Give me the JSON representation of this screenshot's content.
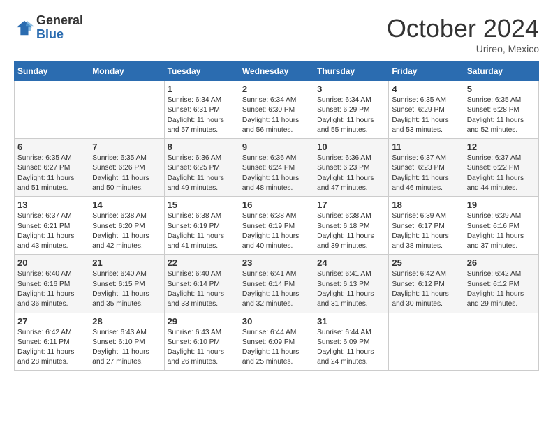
{
  "header": {
    "logo_line1": "General",
    "logo_line2": "Blue",
    "month": "October 2024",
    "location": "Urireo, Mexico"
  },
  "weekdays": [
    "Sunday",
    "Monday",
    "Tuesday",
    "Wednesday",
    "Thursday",
    "Friday",
    "Saturday"
  ],
  "weeks": [
    [
      {
        "day": "",
        "info": ""
      },
      {
        "day": "",
        "info": ""
      },
      {
        "day": "1",
        "info": "Sunrise: 6:34 AM\nSunset: 6:31 PM\nDaylight: 11 hours and 57 minutes."
      },
      {
        "day": "2",
        "info": "Sunrise: 6:34 AM\nSunset: 6:30 PM\nDaylight: 11 hours and 56 minutes."
      },
      {
        "day": "3",
        "info": "Sunrise: 6:34 AM\nSunset: 6:29 PM\nDaylight: 11 hours and 55 minutes."
      },
      {
        "day": "4",
        "info": "Sunrise: 6:35 AM\nSunset: 6:29 PM\nDaylight: 11 hours and 53 minutes."
      },
      {
        "day": "5",
        "info": "Sunrise: 6:35 AM\nSunset: 6:28 PM\nDaylight: 11 hours and 52 minutes."
      }
    ],
    [
      {
        "day": "6",
        "info": "Sunrise: 6:35 AM\nSunset: 6:27 PM\nDaylight: 11 hours and 51 minutes."
      },
      {
        "day": "7",
        "info": "Sunrise: 6:35 AM\nSunset: 6:26 PM\nDaylight: 11 hours and 50 minutes."
      },
      {
        "day": "8",
        "info": "Sunrise: 6:36 AM\nSunset: 6:25 PM\nDaylight: 11 hours and 49 minutes."
      },
      {
        "day": "9",
        "info": "Sunrise: 6:36 AM\nSunset: 6:24 PM\nDaylight: 11 hours and 48 minutes."
      },
      {
        "day": "10",
        "info": "Sunrise: 6:36 AM\nSunset: 6:23 PM\nDaylight: 11 hours and 47 minutes."
      },
      {
        "day": "11",
        "info": "Sunrise: 6:37 AM\nSunset: 6:23 PM\nDaylight: 11 hours and 46 minutes."
      },
      {
        "day": "12",
        "info": "Sunrise: 6:37 AM\nSunset: 6:22 PM\nDaylight: 11 hours and 44 minutes."
      }
    ],
    [
      {
        "day": "13",
        "info": "Sunrise: 6:37 AM\nSunset: 6:21 PM\nDaylight: 11 hours and 43 minutes."
      },
      {
        "day": "14",
        "info": "Sunrise: 6:38 AM\nSunset: 6:20 PM\nDaylight: 11 hours and 42 minutes."
      },
      {
        "day": "15",
        "info": "Sunrise: 6:38 AM\nSunset: 6:19 PM\nDaylight: 11 hours and 41 minutes."
      },
      {
        "day": "16",
        "info": "Sunrise: 6:38 AM\nSunset: 6:19 PM\nDaylight: 11 hours and 40 minutes."
      },
      {
        "day": "17",
        "info": "Sunrise: 6:38 AM\nSunset: 6:18 PM\nDaylight: 11 hours and 39 minutes."
      },
      {
        "day": "18",
        "info": "Sunrise: 6:39 AM\nSunset: 6:17 PM\nDaylight: 11 hours and 38 minutes."
      },
      {
        "day": "19",
        "info": "Sunrise: 6:39 AM\nSunset: 6:16 PM\nDaylight: 11 hours and 37 minutes."
      }
    ],
    [
      {
        "day": "20",
        "info": "Sunrise: 6:40 AM\nSunset: 6:16 PM\nDaylight: 11 hours and 36 minutes."
      },
      {
        "day": "21",
        "info": "Sunrise: 6:40 AM\nSunset: 6:15 PM\nDaylight: 11 hours and 35 minutes."
      },
      {
        "day": "22",
        "info": "Sunrise: 6:40 AM\nSunset: 6:14 PM\nDaylight: 11 hours and 33 minutes."
      },
      {
        "day": "23",
        "info": "Sunrise: 6:41 AM\nSunset: 6:14 PM\nDaylight: 11 hours and 32 minutes."
      },
      {
        "day": "24",
        "info": "Sunrise: 6:41 AM\nSunset: 6:13 PM\nDaylight: 11 hours and 31 minutes."
      },
      {
        "day": "25",
        "info": "Sunrise: 6:42 AM\nSunset: 6:12 PM\nDaylight: 11 hours and 30 minutes."
      },
      {
        "day": "26",
        "info": "Sunrise: 6:42 AM\nSunset: 6:12 PM\nDaylight: 11 hours and 29 minutes."
      }
    ],
    [
      {
        "day": "27",
        "info": "Sunrise: 6:42 AM\nSunset: 6:11 PM\nDaylight: 11 hours and 28 minutes."
      },
      {
        "day": "28",
        "info": "Sunrise: 6:43 AM\nSunset: 6:10 PM\nDaylight: 11 hours and 27 minutes."
      },
      {
        "day": "29",
        "info": "Sunrise: 6:43 AM\nSunset: 6:10 PM\nDaylight: 11 hours and 26 minutes."
      },
      {
        "day": "30",
        "info": "Sunrise: 6:44 AM\nSunset: 6:09 PM\nDaylight: 11 hours and 25 minutes."
      },
      {
        "day": "31",
        "info": "Sunrise: 6:44 AM\nSunset: 6:09 PM\nDaylight: 11 hours and 24 minutes."
      },
      {
        "day": "",
        "info": ""
      },
      {
        "day": "",
        "info": ""
      }
    ]
  ]
}
